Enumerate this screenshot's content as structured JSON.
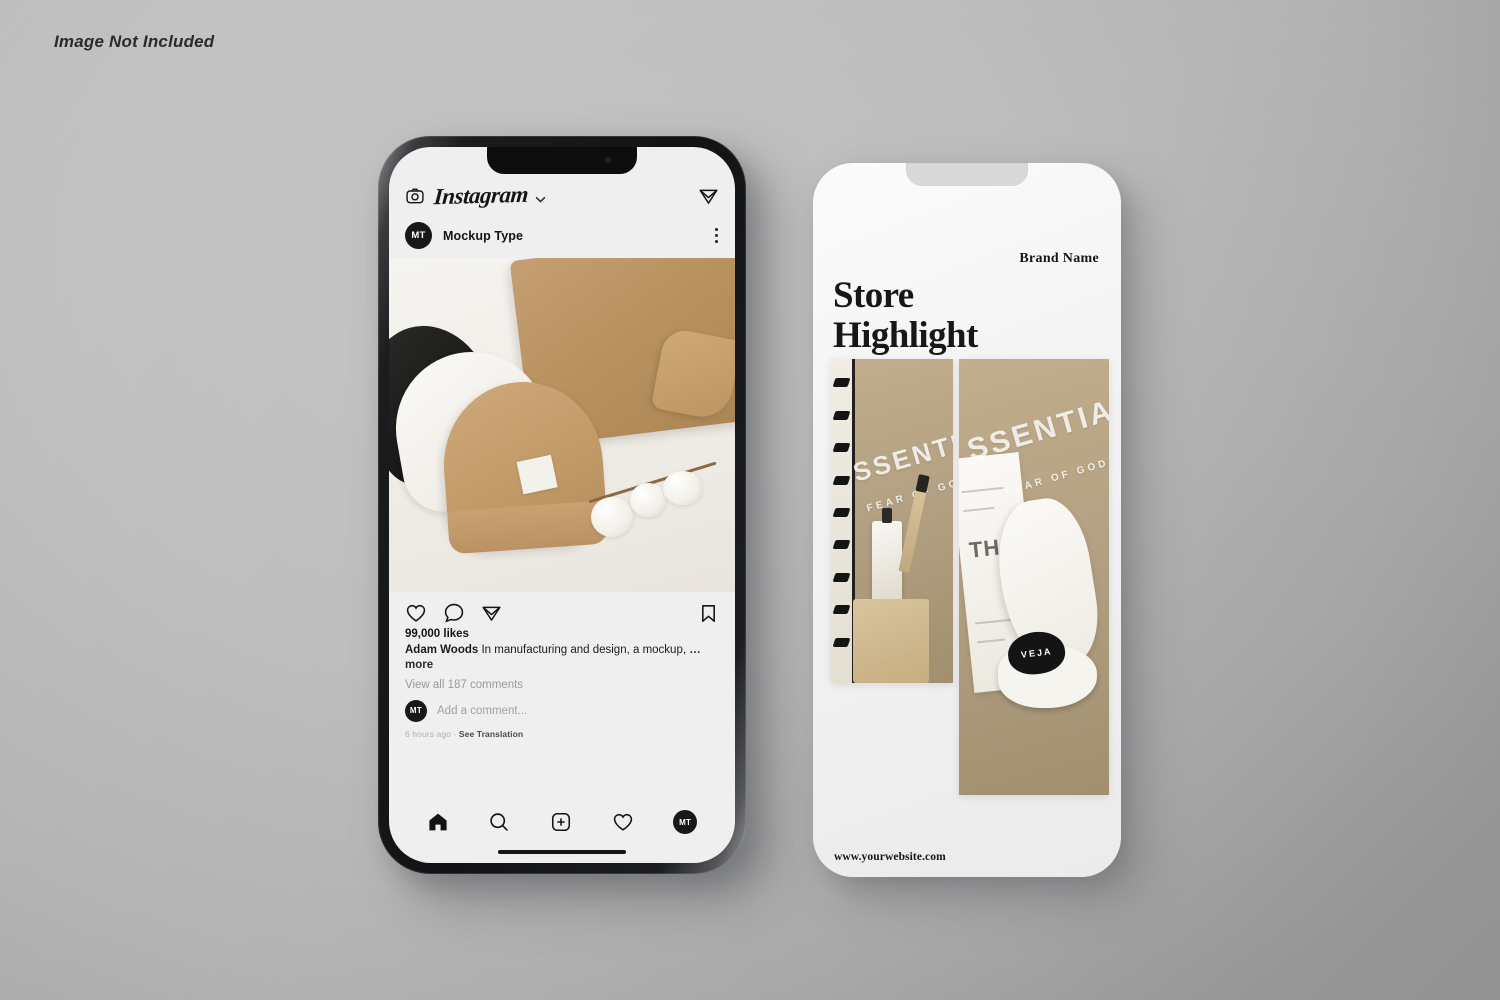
{
  "watermark": "Image Not Included",
  "background": {
    "base_color": "#dcdcdc",
    "shadow_color": "#bcbcbc"
  },
  "left_phone": {
    "device": "smartphone-dark-bezel",
    "app": {
      "name": "Instagram",
      "topbar": {
        "camera_icon": "camera-icon",
        "wordmark": "Instagram",
        "chevron": "⌄",
        "share_icon": "send-icon"
      },
      "post": {
        "avatar_initials": "MT",
        "username": "Mockup Type",
        "menu_icon": "kebab-menu-icon",
        "image_alt": "flat lay of black, white and tan beanies with tan sweater and cotton branch",
        "actions": {
          "like_icon": "heart-icon",
          "comment_icon": "comment-icon",
          "share_icon": "send-icon",
          "save_icon": "bookmark-icon"
        },
        "likes": "99,000 likes",
        "caption_author": "Adam Woods",
        "caption_text": "In manufacturing and design, a mockup,",
        "caption_more": "… more",
        "view_comments": "View all 187 comments",
        "comment_avatar_initials": "MT",
        "comment_placeholder": "Add a comment...",
        "timestamp": "6 hours ago",
        "timestamp_separator": "·",
        "translation_link": "See Translation"
      },
      "nav": {
        "home_icon": "home-icon",
        "search_icon": "search-icon",
        "add_icon": "plus-square-icon",
        "activity_icon": "heart-icon",
        "profile_initials": "MT"
      }
    }
  },
  "right_phone": {
    "device": "smartphone-screen-only",
    "story": {
      "brand_name": "Brand Name",
      "title_line1": "Store",
      "title_line2": "Highlight",
      "website": "www.yourwebsite.com",
      "photo_a": {
        "alt": "perfume bottle and kraft pouch on tan fabric",
        "overlay_big": "SSENTIAL",
        "overlay_small": "FEAR OF GOD"
      },
      "photo_b": {
        "alt": "white VEJA sneaker on tan fabric with paper",
        "overlay_big": "SSENTIAL",
        "overlay_small": "FEAR OF GOD",
        "shoe_brand": "VEJA",
        "paper_text": "TH"
      }
    }
  }
}
